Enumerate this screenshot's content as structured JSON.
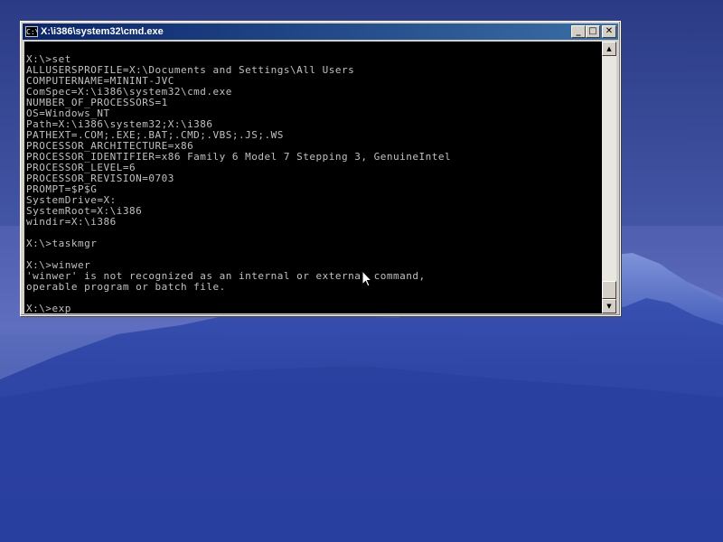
{
  "window": {
    "title": "X:\\i386\\system32\\cmd.exe",
    "icon": "cmd-prompt-icon",
    "icon_label": "C:\\",
    "controls": {
      "minimize": "_",
      "maximize": "□",
      "close": "✕"
    }
  },
  "console": {
    "lines": [
      "",
      "X:\\>set",
      "ALLUSERSPROFILE=X:\\Documents and Settings\\All Users",
      "COMPUTERNAME=MININT-JVC",
      "ComSpec=X:\\i386\\system32\\cmd.exe",
      "NUMBER_OF_PROCESSORS=1",
      "OS=Windows_NT",
      "Path=X:\\i386\\system32;X:\\i386",
      "PATHEXT=.COM;.EXE;.BAT;.CMD;.VBS;.JS;.WS",
      "PROCESSOR_ARCHITECTURE=x86",
      "PROCESSOR_IDENTIFIER=x86 Family 6 Model 7 Stepping 3, GenuineIntel",
      "PROCESSOR_LEVEL=6",
      "PROCESSOR_REVISION=0703",
      "PROMPT=$P$G",
      "SystemDrive=X:",
      "SystemRoot=X:\\i386",
      "windir=X:\\i386",
      "",
      "X:\\>taskmgr",
      "",
      "X:\\>winwer",
      "'winwer' is not recognized as an internal or external command,",
      "operable program or batch file.",
      "",
      "X:\\>exp"
    ],
    "text_color": "#c0c0c0",
    "background": "#000000"
  },
  "scrollbar": {
    "up_arrow": "▲",
    "down_arrow": "▼",
    "position": "bottom"
  },
  "colors": {
    "titlebar_start": "#0a246a",
    "titlebar_end": "#3a6ea5",
    "window_face": "#d4d0c8"
  }
}
